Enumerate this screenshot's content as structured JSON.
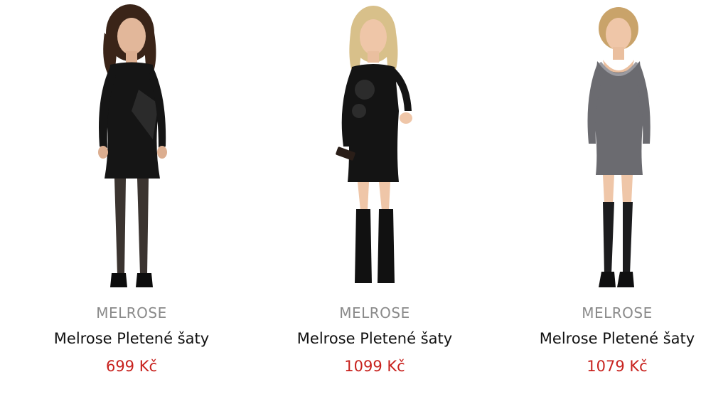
{
  "colors": {
    "brand_text": "#8a8a8a",
    "name_text": "#111111",
    "price_text": "#c8221e",
    "background": "#ffffff"
  },
  "products": [
    {
      "brand": "MELROSE",
      "name": "Melrose Pletené šaty",
      "price": "699 Kč",
      "image_alt": "black-long-sleeve-knit-dress-photo"
    },
    {
      "brand": "MELROSE",
      "name": "Melrose Pletené šaty",
      "price": "1099 Kč",
      "image_alt": "black-knit-dress-with-boots-photo"
    },
    {
      "brand": "MELROSE",
      "name": "Melrose Pletené šaty",
      "price": "1079 Kč",
      "image_alt": "grey-knit-dress-with-stockings-photo"
    }
  ]
}
